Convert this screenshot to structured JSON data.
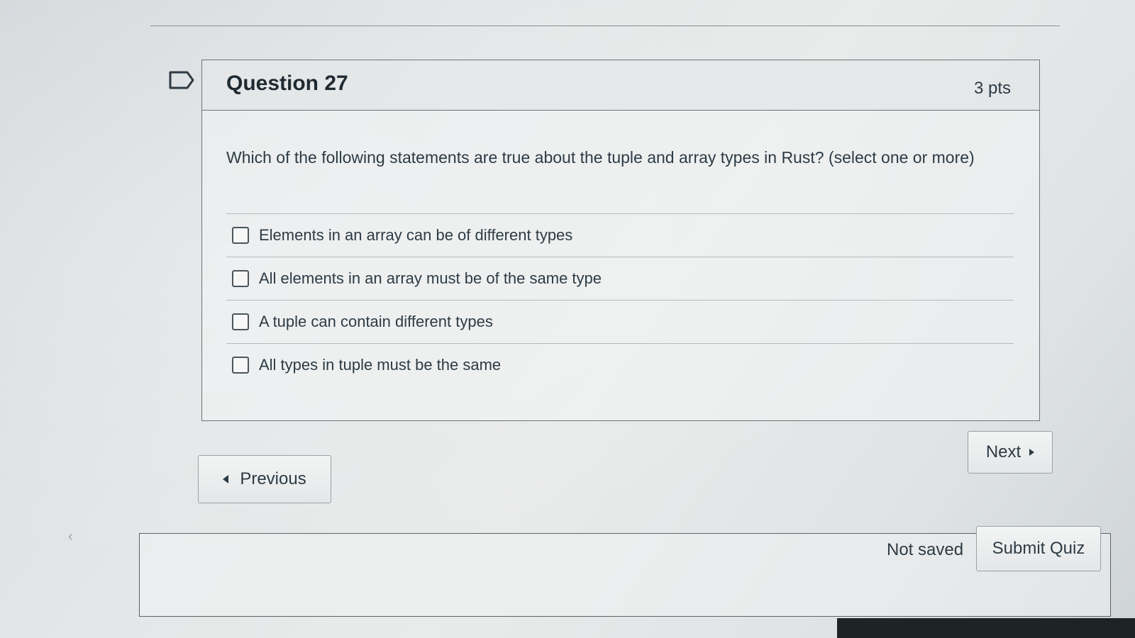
{
  "question": {
    "title": "Question 27",
    "points": "3 pts",
    "text": "Which of the following statements are true about the tuple and array types in Rust? (select one or more)",
    "answers": [
      {
        "label": "Elements in an array can be of different types",
        "checked": false
      },
      {
        "label": "All elements in an array must be of the same type",
        "checked": false
      },
      {
        "label": "A tuple can contain different types",
        "checked": false
      },
      {
        "label": "All types in tuple must be the same",
        "checked": false
      }
    ]
  },
  "navigation": {
    "previous_label": "Previous",
    "next_label": "Next"
  },
  "footer": {
    "save_status": "Not saved",
    "submit_label": "Submit Quiz"
  },
  "icons": {
    "flag": "flag-outline-icon",
    "previous": "caret-left-icon",
    "next": "caret-right-icon"
  },
  "colors": {
    "text": "#2d3b45",
    "border": "#6e7377"
  }
}
